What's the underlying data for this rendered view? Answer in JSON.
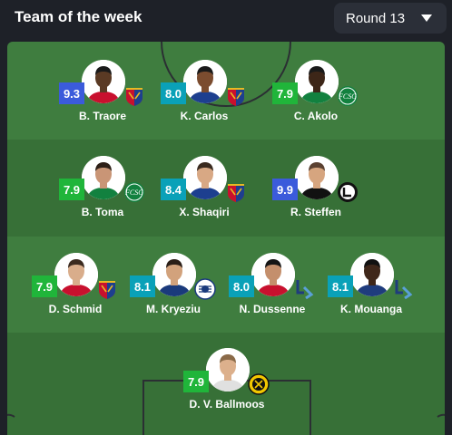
{
  "header": {
    "title": "Team of the week"
  },
  "round_selector": {
    "value": "Round 13",
    "icon": "chevron-down-icon"
  },
  "colors": {
    "rating_blue": "#3b5bdb",
    "rating_teal": "#0aa1b8",
    "rating_green": "#20b53a",
    "pitch_light": "#3f7d3f",
    "pitch_dark": "#376f37",
    "background": "#1e2128"
  },
  "players": [
    {
      "name": "B. Traore",
      "rating": "9.3",
      "rating_color": "#3b5bdb",
      "club": "basel"
    },
    {
      "name": "K. Carlos",
      "rating": "8.0",
      "rating_color": "#0aa1b8",
      "club": "basel"
    },
    {
      "name": "C. Akolo",
      "rating": "7.9",
      "rating_color": "#20b53a",
      "club": "st-gallen"
    },
    {
      "name": "B. Toma",
      "rating": "7.9",
      "rating_color": "#20b53a",
      "club": "st-gallen"
    },
    {
      "name": "X. Shaqiri",
      "rating": "8.4",
      "rating_color": "#0aa1b8",
      "club": "basel"
    },
    {
      "name": "R. Steffen",
      "rating": "9.9",
      "rating_color": "#3b5bdb",
      "club": "lugano"
    },
    {
      "name": "D. Schmid",
      "rating": "7.9",
      "rating_color": "#20b53a",
      "club": "basel"
    },
    {
      "name": "M. Kryeziu",
      "rating": "8.1",
      "rating_color": "#0aa1b8",
      "club": "fcz"
    },
    {
      "name": "N. Dussenne",
      "rating": "8.0",
      "rating_color": "#0aa1b8",
      "club": "lausanne"
    },
    {
      "name": "K. Mouanga",
      "rating": "8.1",
      "rating_color": "#0aa1b8",
      "club": "lausanne"
    },
    {
      "name": "D. V. Ballmoos",
      "rating": "7.9",
      "rating_color": "#20b53a",
      "club": "young-boys"
    }
  ]
}
